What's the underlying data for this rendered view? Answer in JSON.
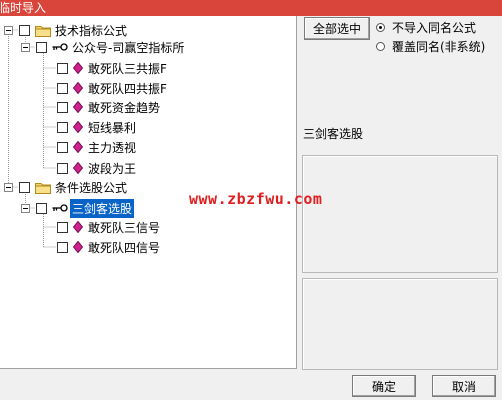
{
  "window": {
    "title": "临时导入"
  },
  "tree": {
    "groups": [
      {
        "label": "技术指标公式",
        "children": [
          {
            "label": "公众号-司赢空指标所",
            "items": [
              "敢死队三共振F",
              "敢死队四共振F",
              "敢死资金趋势",
              "短线暴利",
              "主力透视",
              "波段为王"
            ]
          }
        ]
      },
      {
        "label": "条件选股公式",
        "children": [
          {
            "label": "三剑客选股",
            "items": [
              "敢死队三信号",
              "敢死队四信号"
            ]
          }
        ]
      }
    ]
  },
  "options": {
    "select_all_label": "全部选中",
    "radio": [
      {
        "label": "不导入同名公式",
        "checked": true
      },
      {
        "label": "覆盖同名(非系统)",
        "checked": false
      }
    ]
  },
  "info": {
    "selected_name": "三剑客选股"
  },
  "watermark": "www.zbzfwu.com",
  "footer": {
    "ok_label": "确定",
    "cancel_label": "取消"
  },
  "colors": {
    "title_bar": "#d9453a",
    "selection": "#0a64c8",
    "gem": "#d02090",
    "watermark": "#e02020"
  }
}
